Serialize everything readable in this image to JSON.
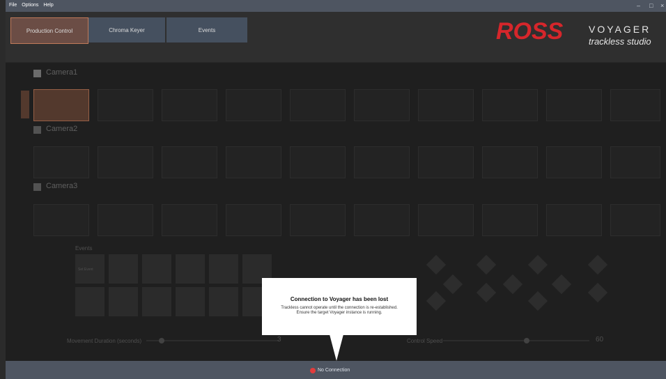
{
  "window": {
    "title": "Voyager Trackless Studio"
  },
  "menu": {
    "file": "File",
    "options": "Options",
    "help": "Help"
  },
  "window_controls": {
    "minimize": "–",
    "maximize": "□",
    "close": "×"
  },
  "tabs": [
    {
      "label": "Production Control"
    },
    {
      "label": "Chroma Keyer"
    },
    {
      "label": "Events"
    }
  ],
  "branding": {
    "ross": "ROSS",
    "voyager": "VOYAGER",
    "trackless": "trackless studio"
  },
  "cameras": [
    {
      "label": "Camera1",
      "checked": true
    },
    {
      "label": "Camera2",
      "checked": false
    },
    {
      "label": "Camera3",
      "checked": false
    }
  ],
  "events": {
    "label": "Events",
    "first_item": "Set Event"
  },
  "movement": {
    "label": "Movement Duration (seconds)",
    "value": "3"
  },
  "control_speed": {
    "label": "Control Speed",
    "value": "60"
  },
  "dialog": {
    "title": "Connection to Voyager has been lost",
    "line1": "Trackless cannot operate until the connection is re-established.",
    "line2": "Ensure the target Voyager instance is running."
  },
  "status": {
    "text": "No Connection",
    "color": "#e23c3c"
  }
}
